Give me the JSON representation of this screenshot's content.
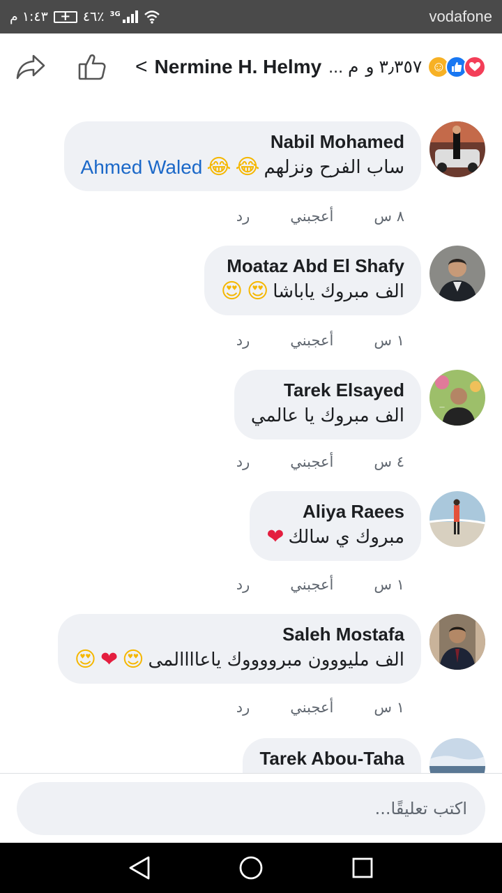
{
  "statusbar": {
    "time": "١:٤٣ م",
    "battery": "٤٦٪",
    "network": "3G",
    "carrier": "vodafone"
  },
  "header": {
    "title": "Nermine H. Helmy",
    "count": "٣٫٣٥٧ و",
    "ellipsis": "... م",
    "reactions": [
      "love",
      "like",
      "care"
    ]
  },
  "comments": [
    {
      "author": "Nabil Mohamed",
      "mention": "Ahmed Waled",
      "text": "ساب الفرح ونزلهم",
      "emojis": [
        "😂",
        "😂"
      ],
      "time": "٨ س",
      "like_label": "أعجبني",
      "reply_label": "رد"
    },
    {
      "author": "Moataz Abd El Shafy",
      "text": "الف مبروك ياباشا",
      "emojis": [
        "😍",
        "😍"
      ],
      "time": "١ س",
      "like_label": "أعجبني",
      "reply_label": "رد"
    },
    {
      "author": "Tarek Elsayed",
      "text": "الف مبروك يا عالمي",
      "emojis": [],
      "time": "٤ س",
      "like_label": "أعجبني",
      "reply_label": "رد"
    },
    {
      "author": "Aliya Raees",
      "text": "مبروك ي سالك",
      "emojis": [
        "❤"
      ],
      "time": "١ س",
      "like_label": "أعجبني",
      "reply_label": "رد"
    },
    {
      "author": "Saleh Mostafa",
      "text": "الف مليووون مبرووووك ياعاااالمى",
      "emojis": [
        "😍",
        "❤",
        "😍"
      ],
      "time": "١ س",
      "like_label": "أعجبني",
      "reply_label": "رد"
    },
    {
      "author": "Tarek Abou-Taha"
    }
  ],
  "composer": {
    "placeholder": "اكتب تعليقًا..."
  },
  "colors": {
    "statusbar": "#4a4a4a",
    "bubble": "#eff1f5",
    "mention": "#1b68c8",
    "meta": "#606770"
  }
}
